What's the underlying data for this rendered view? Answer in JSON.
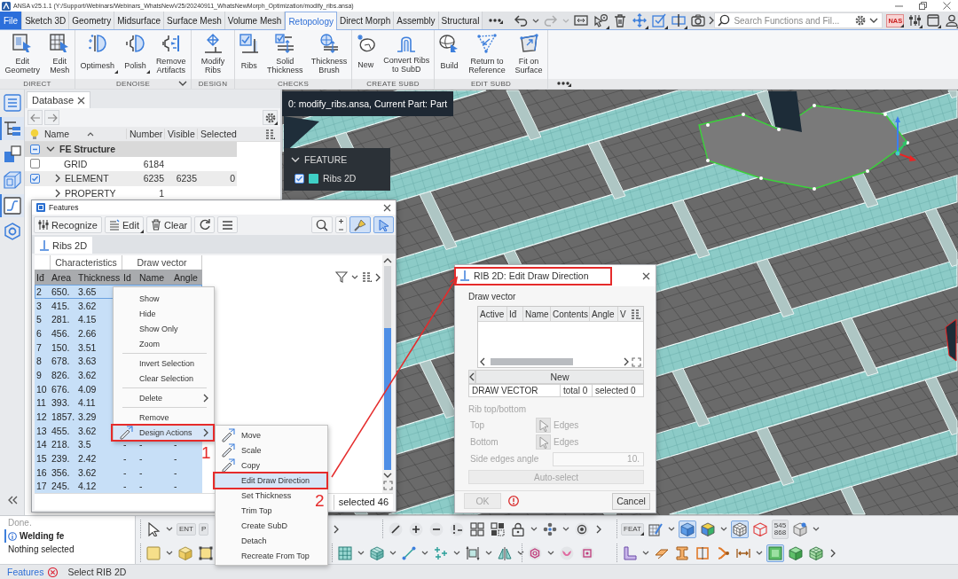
{
  "window": {
    "title": "ANSA v25.1.1 (Y:/Support/Webinars/Webinars_WhatsNewV25/20240911_WhatsNewMorph_Optimization/modify_ribs.ansa)"
  },
  "menu_tabs": [
    {
      "label": "File",
      "kind": "file",
      "selected": false
    },
    {
      "label": "Sketch 3D",
      "kind": "tab",
      "selected": false
    },
    {
      "label": "Geometry",
      "kind": "tab",
      "selected": false
    },
    {
      "label": "Midsurface",
      "kind": "tab",
      "selected": false
    },
    {
      "label": "Surface Mesh",
      "kind": "tab",
      "selected": false
    },
    {
      "label": "Volume Mesh",
      "kind": "tab",
      "selected": false
    },
    {
      "label": "Retopology",
      "kind": "tab",
      "selected": true
    },
    {
      "label": "Direct Morph",
      "kind": "tab",
      "selected": false
    },
    {
      "label": "Assembly",
      "kind": "tab",
      "selected": false
    },
    {
      "label": "Structural",
      "kind": "tab",
      "selected": false
    }
  ],
  "quick_toolbar": [
    {
      "dropdown": true,
      "disabled": false
    },
    {
      "dropdown": true,
      "disabled": true
    },
    {
      "dropdown": false,
      "disabled": false
    },
    {
      "dropdown": false,
      "disabled": false
    },
    {
      "dropdown": false,
      "disabled": false
    },
    {
      "dropdown": false,
      "disabled": false
    },
    {
      "dropdown": false,
      "disabled": false
    },
    {
      "dropdown": false,
      "disabled": false
    },
    {
      "dropdown": false,
      "disabled": false
    }
  ],
  "search": {
    "placeholder": "Search Functions and Fil..."
  },
  "deck_badge": "NAS",
  "ribbon": {
    "groups": [
      {
        "label": "DIRECT",
        "expander": false,
        "buttons": [
          {
            "label": "Edit\nGeometry"
          },
          {
            "label": "Edit\nMesh"
          }
        ]
      },
      {
        "label": "DENOISE",
        "expander": true,
        "buttons": [
          {
            "label": "Optimesh"
          },
          {
            "label": "Polish"
          },
          {
            "label": "Remove\nArtifacts"
          }
        ]
      },
      {
        "label": "DESIGN",
        "expander": false,
        "buttons": [
          {
            "label": "Modify\nRibs"
          }
        ]
      },
      {
        "label": "CHECKS",
        "expander": false,
        "buttons": [
          {
            "label": "Ribs"
          },
          {
            "label": "Solid\nThickness"
          },
          {
            "label": "Thickness\nBrush"
          }
        ]
      },
      {
        "label": "CREATE SUBD",
        "expander": false,
        "buttons": [
          {
            "label": "New"
          },
          {
            "label": "Convert Ribs\nto SubD"
          }
        ]
      },
      {
        "label": "EDIT SUBD",
        "expander": false,
        "buttons": [
          {
            "label": "Build"
          },
          {
            "label": "Return to\nReference"
          },
          {
            "label": "Fit on\nSurface"
          }
        ]
      }
    ]
  },
  "side_tabs": [
    {
      "selected": false
    },
    {
      "selected": true
    },
    {
      "selected": false
    },
    {
      "selected": false
    },
    {
      "selected": true
    },
    {
      "selected": false
    }
  ],
  "database": {
    "tab": "Database",
    "columns": [
      "Name",
      "Number",
      "Visible",
      "Selected"
    ],
    "rows": [
      {
        "name": "FE Structure",
        "checked": false,
        "partial": true,
        "expanded": true,
        "selected": false,
        "children": [
          {
            "name": "GRID",
            "checked": false,
            "partial": false,
            "selected": false,
            "cells": [
              "6184"
            ]
          },
          {
            "name": "ELEMENT",
            "checked": true,
            "partial": false,
            "expanded": false,
            "selected": true,
            "cells": [
              "6235",
              "6235",
              "0"
            ]
          },
          {
            "name": "PROPERTY",
            "expanded": false,
            "selected": false,
            "cells": [
              "1"
            ]
          }
        ]
      }
    ]
  },
  "viewport": {
    "info": "0: modify_ribs.ansa, Current Part: Part",
    "feature_panel": {
      "title": "FEATURE",
      "expanded": true,
      "items": [
        {
          "label": "Ribs 2D",
          "checked": true,
          "color": "#3fd0c6"
        }
      ]
    }
  },
  "features_window": {
    "title": "Features",
    "toolbar": [
      {
        "label": "Recognize"
      },
      {
        "label": "Edit"
      },
      {
        "label": "Clear"
      }
    ],
    "toggles": [
      {
        "selected": true
      },
      {
        "selected": true
      }
    ],
    "tabs": [
      {
        "label": "Ribs 2D",
        "selected": true
      }
    ],
    "column_groups": [
      "Characteristics",
      "Draw vector"
    ],
    "columns": [
      "Iđ",
      "Area",
      "Thickness",
      "Id",
      "Name",
      "Angle"
    ],
    "rows": [
      {
        "cells": [
          "2",
          "650.",
          "3.65"
        ],
        "selected": true,
        "current": true
      },
      {
        "cells": [
          "3",
          "415.",
          "3.62"
        ],
        "selected": true,
        "current": false
      },
      {
        "cells": [
          "5",
          "281.",
          "4.15"
        ],
        "selected": true,
        "current": false
      },
      {
        "cells": [
          "6",
          "456.",
          "2.66"
        ],
        "selected": true,
        "current": false
      },
      {
        "cells": [
          "7",
          "150.",
          "3.51"
        ],
        "selected": true,
        "current": false
      },
      {
        "cells": [
          "8",
          "678.",
          "3.63"
        ],
        "selected": true,
        "current": false
      },
      {
        "cells": [
          "9",
          "826.",
          "3.62"
        ],
        "selected": true,
        "current": false
      },
      {
        "cells": [
          "10",
          "676.",
          "4.09"
        ],
        "selected": true,
        "current": false
      },
      {
        "cells": [
          "11",
          "393.",
          "4.11"
        ],
        "selected": true,
        "current": false
      },
      {
        "cells": [
          "12",
          "1857.",
          "3.29"
        ],
        "selected": true,
        "current": false
      },
      {
        "cells": [
          "13",
          "455.",
          "3.62"
        ],
        "selected": true,
        "current": false
      },
      {
        "cells": [
          "14",
          "218.",
          "3.5",
          "-",
          "-",
          "-"
        ],
        "selected": true,
        "current": false
      },
      {
        "cells": [
          "15",
          "239.",
          "2.42",
          "-",
          "-",
          "-"
        ],
        "selected": true,
        "current": false
      },
      {
        "cells": [
          "16",
          "356.",
          "3.62",
          "-",
          "-",
          "-"
        ],
        "selected": true,
        "current": false
      },
      {
        "cells": [
          "17",
          "245.",
          "4.12",
          "-",
          "-",
          "-"
        ],
        "selected": true,
        "current": false
      }
    ],
    "footer": "selected 46"
  },
  "context_menu": {
    "items": [
      {
        "kind": "item",
        "label": "Show",
        "icon": false,
        "submenu": false,
        "selected": false,
        "framed": false
      },
      {
        "kind": "item",
        "label": "Hide",
        "icon": false,
        "submenu": false,
        "selected": false,
        "framed": false
      },
      {
        "kind": "item",
        "label": "Show Only",
        "icon": false,
        "submenu": false,
        "selected": false,
        "framed": false
      },
      {
        "kind": "item",
        "label": "Zoom",
        "icon": false,
        "submenu": false,
        "selected": false,
        "framed": false
      },
      {
        "kind": "separator"
      },
      {
        "kind": "item",
        "label": "Invert Selection",
        "icon": false,
        "submenu": false,
        "selected": false,
        "framed": false
      },
      {
        "kind": "item",
        "label": "Clear Selection",
        "icon": false,
        "submenu": false,
        "selected": false,
        "framed": false
      },
      {
        "kind": "separator"
      },
      {
        "kind": "item",
        "label": "Delete",
        "icon": false,
        "submenu": true,
        "selected": false,
        "framed": false
      },
      {
        "kind": "separator"
      },
      {
        "kind": "item",
        "label": "Remove",
        "icon": false,
        "submenu": false,
        "selected": false,
        "framed": false
      },
      {
        "kind": "item",
        "label": "Design Actions",
        "icon": true,
        "submenu": true,
        "selected": true,
        "framed": true,
        "callout": "1"
      }
    ]
  },
  "submenu": {
    "items": [
      {
        "kind": "item",
        "label": "Move",
        "icon": true,
        "submenu": false,
        "selected": false,
        "framed": false
      },
      {
        "kind": "item",
        "label": "Scale",
        "icon": true,
        "submenu": false,
        "selected": false,
        "framed": false
      },
      {
        "kind": "item",
        "label": "Copy",
        "icon": true,
        "submenu": false,
        "selected": false,
        "framed": false
      },
      {
        "kind": "item",
        "label": "Edit Draw Direction",
        "icon": false,
        "submenu": false,
        "selected": true,
        "framed": true,
        "callout": "2"
      },
      {
        "kind": "item",
        "label": "Set Thickness",
        "icon": false,
        "submenu": false,
        "selected": false,
        "framed": false
      },
      {
        "kind": "item",
        "label": "Trim Top",
        "icon": false,
        "submenu": false,
        "selected": false,
        "framed": false
      },
      {
        "kind": "item",
        "label": "Create SubD",
        "icon": false,
        "submenu": false,
        "selected": false,
        "framed": false
      },
      {
        "kind": "item",
        "label": "Detach",
        "icon": false,
        "submenu": false,
        "selected": false,
        "framed": false
      },
      {
        "kind": "item",
        "label": "Recreate From Top",
        "icon": false,
        "submenu": false,
        "selected": false,
        "framed": false
      }
    ]
  },
  "edit_dialog": {
    "title": "RIB 2D: Edit Draw Direction",
    "framed": true,
    "pointed_by_arrow": true,
    "section": "Draw vector",
    "columns": [
      "Active",
      "Iđ",
      "Name",
      "Contents",
      "Angle",
      "V"
    ],
    "new_button": "New",
    "summary": [
      "DRAW VECTOR",
      "total 0",
      "selected 0"
    ],
    "subsection": {
      "title": "Rib top/bottom",
      "disabled": true,
      "fields": [
        {
          "kind": "pick",
          "label": "Top",
          "value": "Edges"
        },
        {
          "kind": "pick",
          "label": "Bottom",
          "value": "Edges"
        },
        {
          "kind": "number",
          "label": "Side edges angle",
          "value": "10."
        }
      ],
      "action": "Auto-select"
    },
    "ok": {
      "label": "OK",
      "disabled": true
    },
    "error": true,
    "cancel": "Cancel"
  },
  "messages": [
    {
      "kind": "log",
      "text": "Done."
    },
    {
      "kind": "info",
      "text": "Welding fe"
    },
    {
      "kind": "selection",
      "text": "Nothing selected"
    }
  ],
  "bottom_toolbar": {
    "rows": [
      [
        {
          "items": [
            {
              "kind": "tool",
              "dropdown": true,
              "selected": false
            },
            {
              "kind": "text",
              "text": "ENT",
              "dropdown": false,
              "selected": false
            },
            {
              "kind": "text",
              "text": "P",
              "dropdown": false,
              "selected": false
            }
          ]
        },
        {
          "items": [
            {
              "kind": "more"
            }
          ]
        },
        {
          "items": [
            {
              "kind": "tool",
              "dropdown": false,
              "selected": false
            },
            {
              "kind": "tool",
              "dropdown": false,
              "selected": false
            },
            {
              "kind": "tool",
              "dropdown": false,
              "selected": false
            },
            {
              "kind": "tool",
              "dropdown": false,
              "selected": false
            },
            {
              "kind": "tool",
              "dropdown": false,
              "selected": false
            },
            {
              "kind": "tool",
              "dropdown": false,
              "selected": false
            },
            {
              "kind": "tool",
              "dropdown": true,
              "selected": false
            },
            {
              "kind": "tool",
              "dropdown": true,
              "selected": false
            },
            {
              "kind": "tool",
              "dropdown": false,
              "selected": false
            },
            {
              "kind": "more"
            }
          ]
        },
        {
          "items": [
            {
              "kind": "text",
              "text": "FEAT",
              "dropdown": true,
              "selected": false
            },
            {
              "kind": "tool",
              "dropdown": true,
              "selected": false
            },
            {
              "kind": "tool",
              "dropdown": false,
              "selected": true
            },
            {
              "kind": "tool",
              "dropdown": true,
              "selected": false
            },
            {
              "kind": "tool",
              "dropdown": false,
              "selected": true
            },
            {
              "kind": "tool",
              "dropdown": false,
              "selected": false
            },
            {
              "kind": "text",
              "text": "545\n868",
              "dropdown": false,
              "selected": false
            },
            {
              "kind": "tool",
              "dropdown": true,
              "selected": false
            }
          ]
        }
      ],
      [
        {
          "items": [
            {
              "kind": "tool",
              "dropdown": true,
              "selected": false
            },
            {
              "kind": "tool",
              "dropdown": false,
              "selected": false
            },
            {
              "kind": "tool",
              "dropdown": false,
              "selected": false
            }
          ]
        },
        {
          "items": [
            {
              "kind": "tool",
              "dropdown": true,
              "selected": false
            },
            {
              "kind": "tool",
              "dropdown": true,
              "selected": false
            },
            {
              "kind": "tool",
              "dropdown": true,
              "selected": false
            },
            {
              "kind": "tool",
              "dropdown": true,
              "selected": false
            },
            {
              "kind": "tool",
              "dropdown": true,
              "selected": false
            },
            {
              "kind": "tool",
              "dropdown": true,
              "selected": false
            }
          ]
        },
        {
          "items": [
            {
              "kind": "tool",
              "dropdown": true,
              "selected": false
            },
            {
              "kind": "tool",
              "dropdown": false,
              "selected": false
            },
            {
              "kind": "tool",
              "dropdown": false,
              "selected": false
            }
          ]
        },
        {
          "items": [
            {
              "kind": "tool",
              "dropdown": true,
              "selected": false
            },
            {
              "kind": "tool",
              "dropdown": false,
              "selected": false
            },
            {
              "kind": "tool",
              "dropdown": false,
              "selected": false
            },
            {
              "kind": "tool",
              "dropdown": false,
              "selected": false
            },
            {
              "kind": "tool",
              "dropdown": false,
              "selected": false
            },
            {
              "kind": "tool",
              "dropdown": true,
              "selected": false
            },
            {
              "kind": "tool",
              "dropdown": false,
              "selected": true
            },
            {
              "kind": "tool",
              "dropdown": false,
              "selected": false
            },
            {
              "kind": "tool",
              "dropdown": false,
              "selected": false
            },
            {
              "kind": "more"
            }
          ]
        }
      ]
    ]
  },
  "status_bar": {
    "link": "Features",
    "message": "Select RIB 2D"
  }
}
